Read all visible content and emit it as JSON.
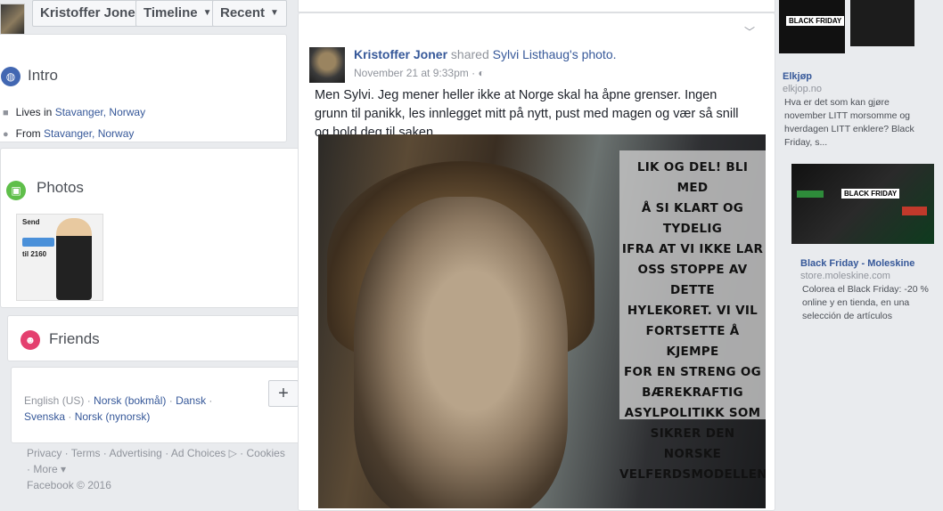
{
  "nav": {
    "profile_name": "Kristoffer Joner",
    "timeline_label": "Timeline",
    "recent_label": "Recent"
  },
  "intro": {
    "title": "Intro",
    "lives_prefix": "Lives in",
    "lives_place": "Stavanger, Norway",
    "from_prefix": "From",
    "from_place": "Stavanger, Norway"
  },
  "photos": {
    "title": "Photos",
    "thumb_text_1": "Send",
    "thumb_text_2": "til 2160"
  },
  "friends": {
    "title": "Friends"
  },
  "languages": {
    "items": [
      "English (US)",
      "Norsk (bokmål)",
      "Dansk",
      "Svenska",
      "Norsk (nynorsk)"
    ],
    "add_label": "+"
  },
  "footer": {
    "links": [
      "Privacy",
      "Terms",
      "Advertising",
      "Ad Choices",
      "Cookies",
      "More"
    ],
    "copyright": "Facebook © 2016"
  },
  "post": {
    "author": "Kristoffer Joner",
    "shared_word": "shared",
    "shared_from": "Sylvi Listhaug",
    "object": "'s photo.",
    "time": "November 21 at 9:33pm",
    "text": "Men Sylvi. Jeg mener heller ikke at Norge skal ha åpne grenser. Ingen grunn til panikk, les innlegget mitt på nytt, pust med magen og vær så snill og hold deg til saken.",
    "image_overlay": [
      "LIK OG DEL! BLI MED",
      "Å SI KLART OG TYDELIG",
      "IFRA AT VI IKKE LAR",
      "OSS STOPPE AV DETTE",
      "HYLEKORET. VI VIL",
      "FORTSETTE Å KJEMPE",
      "FOR EN STRENG OG",
      "BÆREKRAFTIG",
      "ASYLPOLITIKK SOM",
      "SIKRER DEN NORSKE",
      "VELFERDSMODELLEN!"
    ]
  },
  "ads": [
    {
      "image_label": "BLACK FRIDAY",
      "title": "Elkjøp",
      "domain": "elkjop.no",
      "desc": "Hva er det som kan gjøre november LITT morsomme og hverdagen LITT enklere? Black Friday, s..."
    },
    {
      "image_label": "BLACK FRIDAY",
      "title": "Black Friday - Moleskine",
      "domain": "store.moleskine.com",
      "desc": "Colorea el Black Friday: -20 % online y en tienda, en una selección de artículos"
    }
  ],
  "colors": {
    "link": "#365899",
    "background": "#e9ebee",
    "intro_icon": "#4267b2",
    "photos_icon": "#5fbf4a",
    "friends_icon": "#e4406f"
  }
}
